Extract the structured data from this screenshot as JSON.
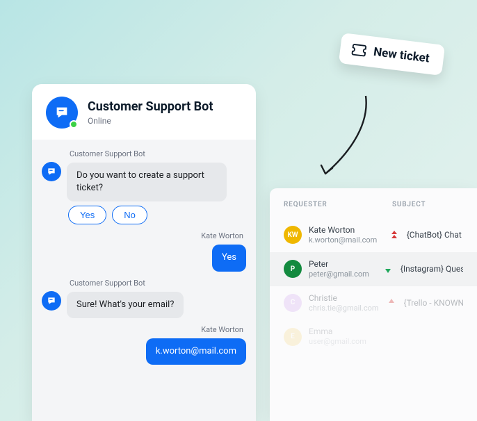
{
  "chat": {
    "title": "Customer Support Bot",
    "status": "Online",
    "bot_name": "Customer Support Bot",
    "user_name": "Kate Worton",
    "messages": {
      "bot_msg_1": "Do you want to create a support ticket?",
      "qr_yes": "Yes",
      "qr_no": "No",
      "user_reply_1": "Yes",
      "bot_msg_2": "Sure! What's your email?",
      "user_reply_2": "k.worton@mail.com"
    }
  },
  "new_ticket": {
    "label": "New ticket"
  },
  "tickets": {
    "header": {
      "requester": "REQUESTER",
      "subject": "SUBJECT"
    },
    "rows": [
      {
        "initials": "KW",
        "avatar_color": "#efb700",
        "name": "Kate Worton",
        "email": "k.worton@mail.com",
        "priority": "high",
        "priority_color": "#d63a3a",
        "subject": "{ChatBot} Chat fo"
      },
      {
        "initials": "P",
        "avatar_color": "#138a3f",
        "name": "Peter",
        "email": "peter@gmail.com",
        "priority": "low",
        "priority_color": "#1fa85b",
        "subject": "{Instagram} Question"
      },
      {
        "initials": "C",
        "avatar_color": "#d9b8f2",
        "name": "Christie",
        "email": "chris.tie@gmail.com",
        "priority": "high",
        "priority_color": "#d63a3a",
        "subject": "{Trello - KNOWN ISSU"
      },
      {
        "initials": "E",
        "avatar_color": "#f5c94c",
        "name": "Emma",
        "email": "user@gmail.com",
        "priority": "",
        "priority_color": "",
        "subject": ""
      }
    ]
  }
}
